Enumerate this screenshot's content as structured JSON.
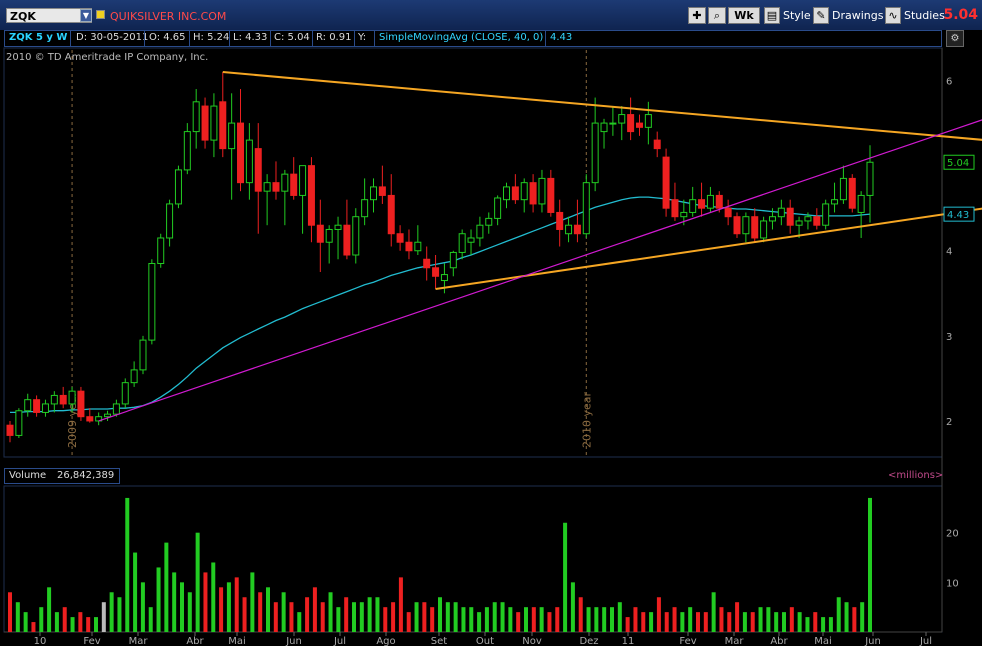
{
  "header": {
    "symbol": "ZQK",
    "company": "QUIKSILVER INC.COM",
    "period_label": "Wk",
    "style_label": "Style",
    "drawings_label": "Drawings",
    "studies_label": "Studies",
    "last_price": "5.04"
  },
  "info": {
    "symbol_period": "ZQK 5 y W",
    "date": "D: 30-05-2011",
    "open": "O: 4.65",
    "high": "H: 5.24",
    "low": "L: 4.33",
    "close": "C: 5.04",
    "range": "R: 0.91",
    "y_label": "Y:",
    "study": "SimpleMovingAvg (CLOSE, 40, 0)",
    "study_value": "4.43"
  },
  "copyright": "2010 © TD Ameritrade IP Company, Inc.",
  "volume_panel": {
    "label": "Volume",
    "value": "26,842,389",
    "units": "<millions>"
  },
  "colors": {
    "up": "#22cc22",
    "down": "#ee2020",
    "sma": "#22bcd0",
    "trendline_orange": "#f5a623",
    "trendline_magenta": "#d01ad0",
    "year_marker": "#8a6a40"
  },
  "chart_data": [
    {
      "type": "candlestick",
      "y_axis_ticks": [
        2,
        3,
        4,
        5,
        6
      ],
      "ylim": [
        1.6,
        6.3
      ],
      "x_ticks": [
        "10",
        "Fev",
        "Mar",
        "Abr",
        "Mai",
        "Jun",
        "Jul",
        "Ago",
        "Set",
        "Out",
        "Nov",
        "Dez",
        "11",
        "Fev",
        "Mar",
        "Abr",
        "Mai",
        "Jun",
        "Jul"
      ],
      "year_markers": [
        "2009 year",
        "2010 year"
      ],
      "price_labels": [
        {
          "value": 5.04,
          "text": "5.04",
          "color": "#22cc22"
        },
        {
          "value": 4.43,
          "text": "4.43",
          "color": "#22bcd0"
        }
      ],
      "candles": [
        [
          1.95,
          2.0,
          1.75,
          1.83
        ],
        [
          1.83,
          2.15,
          1.8,
          2.12
        ],
        [
          2.12,
          2.32,
          2.05,
          2.25
        ],
        [
          2.25,
          2.3,
          2.05,
          2.1
        ],
        [
          2.1,
          2.25,
          2.05,
          2.2
        ],
        [
          2.2,
          2.35,
          2.1,
          2.3
        ],
        [
          2.3,
          2.4,
          2.15,
          2.2
        ],
        [
          2.2,
          2.4,
          2.1,
          2.35
        ],
        [
          2.35,
          2.4,
          2.0,
          2.05
        ],
        [
          2.05,
          2.15,
          1.98,
          2.0
        ],
        [
          2.0,
          2.1,
          1.95,
          2.05
        ],
        [
          2.05,
          2.12,
          2.0,
          2.08
        ],
        [
          2.08,
          2.25,
          2.05,
          2.2
        ],
        [
          2.2,
          2.5,
          2.15,
          2.45
        ],
        [
          2.45,
          2.7,
          2.4,
          2.6
        ],
        [
          2.6,
          3.0,
          2.55,
          2.95
        ],
        [
          2.95,
          3.9,
          2.9,
          3.85
        ],
        [
          3.85,
          4.2,
          3.8,
          4.15
        ],
        [
          4.15,
          4.6,
          4.05,
          4.55
        ],
        [
          4.55,
          5.0,
          4.5,
          4.95
        ],
        [
          4.95,
          5.5,
          4.9,
          5.4
        ],
        [
          5.4,
          5.9,
          5.2,
          5.75
        ],
        [
          5.7,
          5.8,
          5.2,
          5.3
        ],
        [
          5.3,
          5.85,
          5.1,
          5.7
        ],
        [
          5.75,
          6.1,
          5.1,
          5.2
        ],
        [
          5.2,
          5.85,
          4.6,
          5.5
        ],
        [
          5.5,
          5.9,
          4.7,
          4.8
        ],
        [
          4.8,
          5.5,
          4.6,
          5.3
        ],
        [
          5.2,
          5.5,
          4.2,
          4.7
        ],
        [
          4.7,
          4.9,
          4.3,
          4.8
        ],
        [
          4.8,
          5.05,
          4.6,
          4.7
        ],
        [
          4.7,
          4.95,
          4.3,
          4.9
        ],
        [
          4.9,
          5.1,
          4.6,
          4.65
        ],
        [
          4.65,
          5.0,
          4.2,
          5.0
        ],
        [
          5.0,
          5.1,
          4.1,
          4.3
        ],
        [
          4.3,
          4.6,
          3.75,
          4.1
        ],
        [
          4.1,
          4.3,
          3.85,
          4.25
        ],
        [
          4.25,
          4.4,
          3.9,
          4.3
        ],
        [
          4.3,
          4.6,
          3.9,
          3.95
        ],
        [
          3.95,
          4.5,
          3.85,
          4.4
        ],
        [
          4.4,
          4.85,
          4.3,
          4.6
        ],
        [
          4.6,
          4.85,
          4.45,
          4.75
        ],
        [
          4.75,
          5.0,
          4.55,
          4.65
        ],
        [
          4.65,
          4.9,
          4.05,
          4.2
        ],
        [
          4.2,
          4.3,
          4.0,
          4.1
        ],
        [
          4.1,
          4.25,
          3.9,
          4.0
        ],
        [
          4.0,
          4.3,
          3.95,
          4.1
        ],
        [
          3.9,
          4.05,
          3.65,
          3.8
        ],
        [
          3.8,
          3.95,
          3.55,
          3.7
        ],
        [
          3.65,
          3.85,
          3.5,
          3.72
        ],
        [
          3.8,
          4.0,
          3.7,
          3.98
        ],
        [
          3.98,
          4.25,
          3.9,
          4.2
        ],
        [
          4.1,
          4.25,
          3.95,
          4.15
        ],
        [
          4.15,
          4.4,
          4.05,
          4.3
        ],
        [
          4.3,
          4.45,
          4.2,
          4.38
        ],
        [
          4.38,
          4.65,
          4.3,
          4.62
        ],
        [
          4.6,
          4.8,
          4.5,
          4.75
        ],
        [
          4.75,
          4.9,
          4.55,
          4.6
        ],
        [
          4.6,
          4.85,
          4.45,
          4.8
        ],
        [
          4.8,
          4.9,
          4.45,
          4.55
        ],
        [
          4.55,
          4.95,
          4.45,
          4.85
        ],
        [
          4.85,
          4.95,
          4.4,
          4.45
        ],
        [
          4.45,
          4.6,
          4.05,
          4.25
        ],
        [
          4.2,
          4.4,
          4.1,
          4.3
        ],
        [
          4.3,
          4.6,
          4.1,
          4.2
        ],
        [
          4.2,
          4.9,
          4.15,
          4.8
        ],
        [
          4.8,
          5.8,
          4.7,
          5.5
        ],
        [
          5.4,
          5.55,
          5.2,
          5.5
        ],
        [
          5.5,
          5.7,
          5.35,
          5.5
        ],
        [
          5.5,
          5.7,
          5.3,
          5.6
        ],
        [
          5.6,
          5.8,
          5.3,
          5.4
        ],
        [
          5.5,
          5.6,
          5.35,
          5.45
        ],
        [
          5.45,
          5.75,
          5.25,
          5.6
        ],
        [
          5.3,
          5.4,
          5.1,
          5.2
        ],
        [
          5.1,
          5.2,
          4.4,
          4.5
        ],
        [
          4.6,
          4.8,
          4.35,
          4.4
        ],
        [
          4.4,
          4.6,
          4.3,
          4.45
        ],
        [
          4.45,
          4.75,
          4.4,
          4.6
        ],
        [
          4.6,
          4.8,
          4.4,
          4.5
        ],
        [
          4.5,
          4.75,
          4.45,
          4.65
        ],
        [
          4.65,
          4.7,
          4.45,
          4.5
        ],
        [
          4.5,
          4.6,
          4.3,
          4.4
        ],
        [
          4.4,
          4.45,
          4.15,
          4.2
        ],
        [
          4.2,
          4.45,
          4.1,
          4.4
        ],
        [
          4.4,
          4.5,
          4.1,
          4.15
        ],
        [
          4.15,
          4.4,
          4.1,
          4.35
        ],
        [
          4.35,
          4.5,
          4.25,
          4.4
        ],
        [
          4.4,
          4.6,
          4.3,
          4.5
        ],
        [
          4.5,
          4.6,
          4.2,
          4.3
        ],
        [
          4.3,
          4.4,
          4.15,
          4.35
        ],
        [
          4.35,
          4.45,
          4.25,
          4.4
        ],
        [
          4.4,
          4.5,
          4.25,
          4.3
        ],
        [
          4.3,
          4.6,
          4.25,
          4.55
        ],
        [
          4.55,
          4.8,
          4.45,
          4.6
        ],
        [
          4.6,
          5.0,
          4.55,
          4.85
        ],
        [
          4.85,
          4.9,
          4.45,
          4.5
        ],
        [
          4.45,
          4.7,
          4.15,
          4.65
        ],
        [
          4.65,
          5.24,
          4.33,
          5.04
        ]
      ],
      "sma_40": [
        2.1,
        2.1,
        2.11,
        2.11,
        2.11,
        2.12,
        2.12,
        2.13,
        2.13,
        2.14,
        2.14,
        2.14,
        2.15,
        2.15,
        2.16,
        2.18,
        2.22,
        2.28,
        2.35,
        2.43,
        2.52,
        2.62,
        2.7,
        2.78,
        2.86,
        2.92,
        2.98,
        3.03,
        3.08,
        3.13,
        3.18,
        3.22,
        3.27,
        3.32,
        3.36,
        3.4,
        3.44,
        3.48,
        3.52,
        3.56,
        3.6,
        3.63,
        3.67,
        3.71,
        3.74,
        3.77,
        3.8,
        3.82,
        3.84,
        3.86,
        3.88,
        3.92,
        3.95,
        3.99,
        4.03,
        4.07,
        4.11,
        4.15,
        4.19,
        4.23,
        4.27,
        4.31,
        4.35,
        4.39,
        4.43,
        4.47,
        4.51,
        4.54,
        4.57,
        4.6,
        4.62,
        4.63,
        4.63,
        4.62,
        4.61,
        4.59,
        4.57,
        4.55,
        4.53,
        4.52,
        4.51,
        4.5,
        4.49,
        4.49,
        4.48,
        4.47,
        4.46,
        4.45,
        4.44,
        4.43,
        4.42,
        4.41,
        4.41,
        4.41,
        4.41,
        4.41,
        4.42,
        4.43
      ],
      "trendlines": [
        {
          "color": "orange",
          "from": [
            24,
            6.1
          ],
          "to": [
            110,
            5.3
          ]
        },
        {
          "color": "orange",
          "from": [
            48,
            3.55
          ],
          "to": [
            110,
            4.5
          ]
        },
        {
          "color": "magenta",
          "from": [
            10,
            2.0
          ],
          "to": [
            110,
            5.55
          ]
        }
      ]
    },
    {
      "type": "bar",
      "name": "Volume",
      "y_axis_ticks": [
        10,
        20
      ],
      "ylim": [
        0,
        29
      ],
      "values": [
        8,
        6,
        4,
        2,
        5,
        9,
        4,
        5,
        3,
        4,
        3,
        3,
        6,
        8,
        7,
        27,
        16,
        10,
        5,
        13,
        18,
        12,
        10,
        8,
        20,
        12,
        14,
        9,
        10,
        11,
        7,
        12,
        8,
        9,
        6,
        8,
        6,
        4,
        7,
        9,
        6,
        8,
        5,
        7,
        6,
        6,
        7,
        7,
        5,
        6,
        11,
        4,
        6,
        6,
        5,
        7,
        6,
        6,
        5,
        5,
        4,
        5,
        6,
        6,
        5,
        4,
        5,
        5,
        5,
        4,
        5,
        22,
        10,
        7,
        5,
        5,
        5,
        5,
        6,
        3,
        5,
        4,
        4,
        7,
        4,
        5,
        4,
        5,
        4,
        4,
        8,
        5,
        4,
        6,
        4,
        4,
        5,
        5,
        4,
        4,
        5,
        4,
        3,
        4,
        3,
        3,
        7,
        6,
        5,
        6,
        27
      ]
    }
  ]
}
